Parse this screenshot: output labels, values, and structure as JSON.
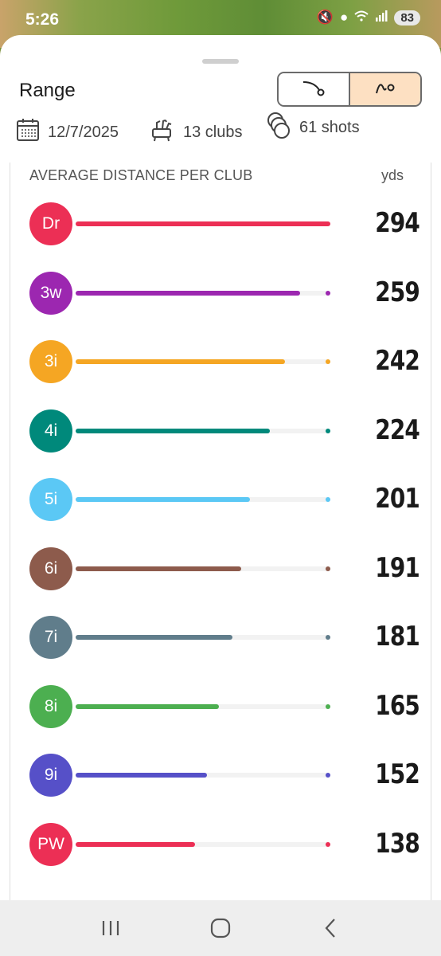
{
  "status": {
    "time": "5:26",
    "battery": "83"
  },
  "sheet": {
    "title": "Range",
    "date": "12/7/2025",
    "clubs": "13 clubs",
    "shots": "61 shots"
  },
  "card": {
    "header": "AVERAGE DISTANCE PER CLUB",
    "unit": "yds",
    "max_distance": 294,
    "clubs": [
      {
        "label": "Dr",
        "distance": "294",
        "value": 294,
        "color": "#ec2f55"
      },
      {
        "label": "3w",
        "distance": "259",
        "value": 259,
        "color": "#9c27b0"
      },
      {
        "label": "3i",
        "distance": "242",
        "value": 242,
        "color": "#f5a623"
      },
      {
        "label": "4i",
        "distance": "224",
        "value": 224,
        "color": "#00897b"
      },
      {
        "label": "5i",
        "distance": "201",
        "value": 201,
        "color": "#5bc8f5"
      },
      {
        "label": "6i",
        "distance": "191",
        "value": 191,
        "color": "#8d5b4c"
      },
      {
        "label": "7i",
        "distance": "181",
        "value": 181,
        "color": "#607d8b"
      },
      {
        "label": "8i",
        "distance": "165",
        "value": 165,
        "color": "#4caf50"
      },
      {
        "label": "9i",
        "distance": "152",
        "value": 152,
        "color": "#5650c8"
      },
      {
        "label": "PW",
        "distance": "138",
        "value": 138,
        "color": "#ec2f55"
      }
    ]
  },
  "icons": {
    "calendar": "calendar-icon",
    "clubs": "golf-bag-icon",
    "shots": "balls-icon",
    "shot-shape": "shot-shape-icon",
    "trajectory": "trajectory-icon"
  }
}
